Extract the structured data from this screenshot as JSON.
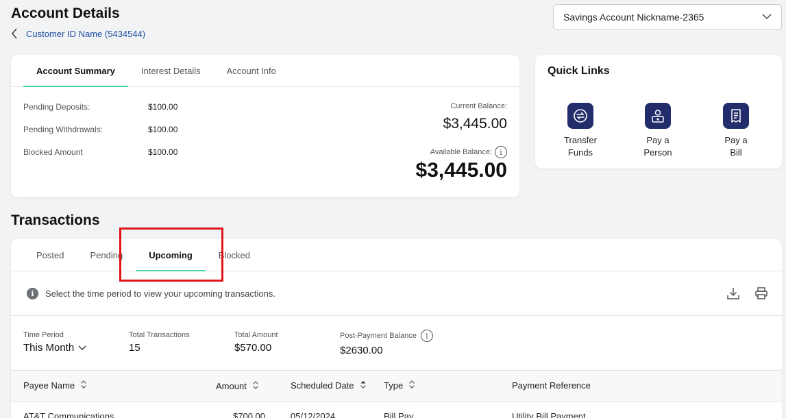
{
  "header": {
    "title": "Account Details",
    "breadcrumb": "Customer ID Name (5434544)",
    "account_select": "Savings Account Nickname-2365"
  },
  "summary": {
    "tabs": [
      "Account Summary",
      "Interest Details",
      "Account Info"
    ],
    "rows": [
      {
        "label": "Pending Deposits:",
        "value": "$100.00"
      },
      {
        "label": "Pending Withdrawals:",
        "value": "$100.00"
      },
      {
        "label": "Blocked Amount",
        "value": "$100.00"
      }
    ],
    "current_balance_label": "Current Balance:",
    "current_balance": "$3,445.00",
    "available_balance_label": "Available Balance:",
    "available_balance": "$3,445.00"
  },
  "quick_links": {
    "title": "Quick Links",
    "items": [
      {
        "label_line1": "Transfer",
        "label_line2": "Funds",
        "icon": "transfer-icon"
      },
      {
        "label_line1": "Pay a",
        "label_line2": "Person",
        "icon": "person-pay-icon"
      },
      {
        "label_line1": "Pay a",
        "label_line2": "Bill",
        "icon": "bill-icon"
      }
    ]
  },
  "transactions": {
    "title": "Transactions",
    "tabs": [
      "Posted",
      "Pending",
      "Upcoming",
      "Blocked"
    ],
    "notice": "Select the time period to view your upcoming transactions.",
    "stats": {
      "time_period_label": "Time Period",
      "time_period_value": "This Month",
      "total_transactions_label": "Total Transactions",
      "total_transactions_value": "15",
      "total_amount_label": "Total Amount",
      "total_amount_value": "$570.00",
      "post_balance_label": "Post-Payment Balance",
      "post_balance_value": "$2630.00"
    },
    "columns": [
      "Payee Name",
      "Amount",
      "Scheduled Date",
      "Type",
      "Payment Reference"
    ],
    "rows": [
      {
        "payee": "AT&T Communications",
        "amount": "$700.00",
        "date": "05/12/2024",
        "type": "Bill Pay",
        "reference": "Utility Bill Payment"
      }
    ]
  },
  "colors": {
    "accent": "#4fd3b1",
    "icon_bg": "#232d6b",
    "link": "#1d4e9e",
    "highlight": "#e0141b"
  }
}
